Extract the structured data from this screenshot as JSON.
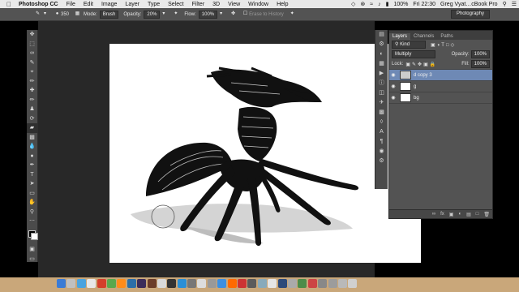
{
  "menubar": {
    "app_name": "Photoshop CC",
    "menus": [
      "File",
      "Edit",
      "Image",
      "Layer",
      "Type",
      "Select",
      "Filter",
      "3D",
      "View",
      "Window",
      "Help"
    ],
    "battery": "100%",
    "time": "Fri 22:30",
    "user": "Greg Vyat…cBook Pro"
  },
  "options": {
    "brush_size": "350",
    "mode_label": "Mode:",
    "mode_value": "Brush",
    "opacity_label": "Opacity:",
    "opacity_value": "20%",
    "flow_label": "Flow:",
    "flow_value": "100%",
    "erase_history": "Erase to History",
    "workspace": "Photography"
  },
  "layers_panel": {
    "tabs": [
      "Layers",
      "Channels",
      "Paths"
    ],
    "filter_kind": "Kind",
    "blend_mode": "Multiply",
    "opacity_label": "Opacity:",
    "opacity_value": "100%",
    "lock_label": "Lock:",
    "fill_label": "Fill:",
    "fill_value": "100%",
    "layers": [
      {
        "name": "d copy 3",
        "selected": true
      },
      {
        "name": "g",
        "selected": false
      },
      {
        "name": "bg",
        "selected": false
      }
    ]
  },
  "colors": {
    "menubar": "#e9e9e9",
    "ui_dark": "#535353",
    "workspace": "#282828",
    "canvas": "#ffffff",
    "selected_layer": "#6e89b5"
  }
}
